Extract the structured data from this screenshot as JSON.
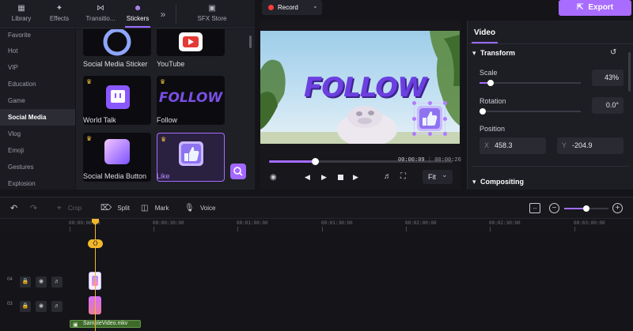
{
  "library": {
    "tabs": [
      {
        "label": "Library",
        "icon": "layers-icon"
      },
      {
        "label": "Effects",
        "icon": "sparkle-icon"
      },
      {
        "label": "Transitio...",
        "icon": "bowtie-icon"
      },
      {
        "label": "Stickers",
        "icon": "smiley-icon"
      },
      {
        "label": "SFX Store",
        "icon": "store-icon"
      }
    ],
    "more_label": "»",
    "categories": [
      "Favorite",
      "Hot",
      "VIP",
      "Education",
      "Game",
      "Social Media",
      "Vlog",
      "Emoji",
      "Gestures",
      "Explosion"
    ],
    "active_category": "Social Media",
    "stickers": [
      {
        "label": "Social Media Sticker"
      },
      {
        "label": "YouTube"
      },
      {
        "label": "World Talk"
      },
      {
        "label": "Follow",
        "art_text": "FOLLOW"
      },
      {
        "label": "Social Media Button"
      },
      {
        "label": "Like"
      }
    ]
  },
  "preview": {
    "record_label": "Record",
    "overlay_text": "FOLLOW",
    "current_time": "00:00:09",
    "total_time": "00:00:26",
    "time_separator": "|",
    "progress_fraction": 0.25,
    "fit_label": "Fit"
  },
  "export_label": "Export",
  "properties": {
    "tab_label": "Video",
    "transform_label": "Transform",
    "scale_label": "Scale",
    "scale_value": "43%",
    "scale_fraction": 0.43,
    "rotation_label": "Rotation",
    "rotation_value": "0.0°",
    "position_label": "Position",
    "x_label": "X",
    "x_value": "458.3",
    "y_label": "Y",
    "y_value": "-204.9",
    "compositing_label": "Compositing"
  },
  "timeline": {
    "tools": {
      "crop": "Crop",
      "split": "Split",
      "mark": "Mark",
      "voice": "Voice"
    },
    "ruler": [
      "00:00:00:00",
      "00:00:30:00",
      "00:01:00:00",
      "00:01:30:00",
      "00:02:00:00",
      "00:02:30:00",
      "00:03:00:00"
    ],
    "tracks": [
      "04",
      "03"
    ],
    "clip_label": "SampleVideo.mkv"
  },
  "colors": {
    "accent": "#a86cff",
    "playhead": "#f2b62c",
    "background": "#141419"
  }
}
